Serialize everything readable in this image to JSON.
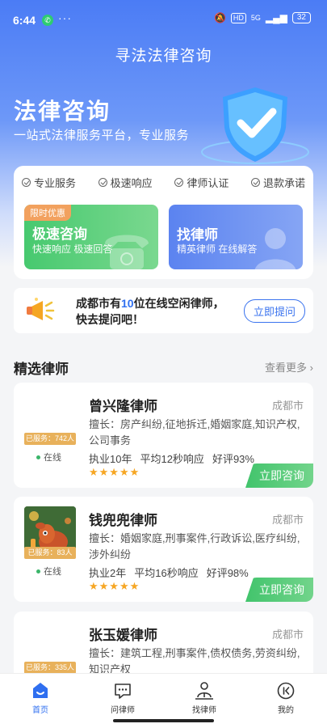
{
  "status_bar": {
    "time": "6:44",
    "battery": "32",
    "network": "5G",
    "hd": "HD"
  },
  "nav": {
    "title": "寻法法律咨询"
  },
  "hero": {
    "title": "法律咨询",
    "subtitle": "一站式法律服务平台，专业服务"
  },
  "features": [
    "专业服务",
    "极速响应",
    "律师认证",
    "退款承诺"
  ],
  "services": [
    {
      "tag": "限时优惠",
      "title": "极速咨询",
      "subtitle": "快速响应 极速回答"
    },
    {
      "title": "找律师",
      "subtitle": "精英律师 在线解答"
    }
  ],
  "promo": {
    "line1_prefix": "成都市有",
    "count": "10",
    "line1_suffix": "位在线空闲律师，",
    "line2": "快去提问吧！",
    "button": "立即提问"
  },
  "section": {
    "title": "精选律师",
    "more": "查看更多"
  },
  "lawyers": [
    {
      "name": "曾兴隆律师",
      "city": "成都市",
      "specialty": "擅长：房产纠纷,征地拆迁,婚姻家庭,知识产权,公司事务",
      "experience": "执业10年",
      "response": "平均12秒响应",
      "rating": "好评93%",
      "served": "已服务：742人",
      "online": "在线",
      "stars": "★★★★★",
      "button": "立即咨询"
    },
    {
      "name": "钱兜兜律师",
      "city": "成都市",
      "specialty": "擅长：婚姻家庭,刑事案件,行政诉讼,医疗纠纷,涉外纠纷",
      "experience": "执业2年",
      "response": "平均16秒响应",
      "rating": "好评98%",
      "served": "已服务：83人",
      "online": "在线",
      "stars": "★★★★★",
      "button": "立即咨询"
    },
    {
      "name": "张玉媛律师",
      "city": "成都市",
      "specialty": "擅长：建筑工程,刑事案件,债权债务,劳资纠纷,知识产权",
      "served": "已服务：335人"
    }
  ],
  "tabs": [
    {
      "label": "首页",
      "icon": "home-icon",
      "active": true
    },
    {
      "label": "问律师",
      "icon": "chat-icon"
    },
    {
      "label": "找律师",
      "icon": "people-icon"
    },
    {
      "label": "我的",
      "icon": "profile-icon"
    }
  ],
  "colors": {
    "primary": "#2f6ff0",
    "green": "#42c46c",
    "gold": "#e8b15b",
    "star": "#f6a623"
  }
}
